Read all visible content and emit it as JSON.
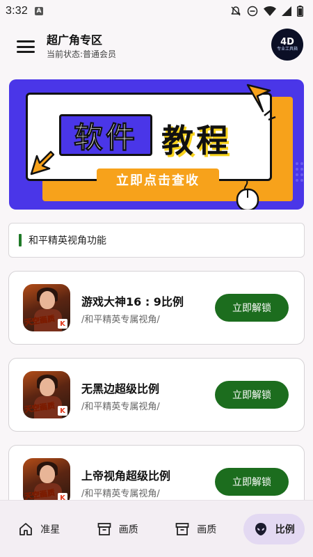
{
  "status_bar": {
    "time": "3:32",
    "notification_icon": "A",
    "icons": [
      "notifications-off-icon",
      "do-not-disturb-icon",
      "wifi-icon",
      "signal-icon",
      "battery-icon"
    ]
  },
  "app_bar": {
    "title": "超广角专区",
    "subtitle": "当前状态:普通会员",
    "avatar": {
      "mark": "4D",
      "text": "专业工具箱"
    }
  },
  "banner": {
    "word1": "软件",
    "word2": "教程",
    "cta": "立即点击查收"
  },
  "section": {
    "title": "和平精英视角功能"
  },
  "items": [
    {
      "name": "游戏大神16 : 9比例",
      "desc": "/和平精英专属视角/",
      "button": "立即解锁",
      "icon_text": "天空画质"
    },
    {
      "name": "无黑边超级比例",
      "desc": "/和平精英专属视角/",
      "button": "立即解锁",
      "icon_text": "天空画质"
    },
    {
      "name": "上帝视角超级比例",
      "desc": "/和平精英专属视角/",
      "button": "立即解锁",
      "icon_text": "天空画质"
    }
  ],
  "bottom_nav": {
    "items": [
      {
        "label": "准星",
        "icon": "home-icon",
        "active": false
      },
      {
        "label": "画质",
        "icon": "archive-icon",
        "active": false
      },
      {
        "label": "画质",
        "icon": "archive-icon",
        "active": false
      },
      {
        "label": "比例",
        "icon": "alien-icon",
        "active": true
      }
    ]
  },
  "colors": {
    "accent_green": "#1c6d1e",
    "banner_blue": "#4a36e8",
    "banner_orange": "#f7a21b",
    "nav_active": "#e3d9f2"
  }
}
